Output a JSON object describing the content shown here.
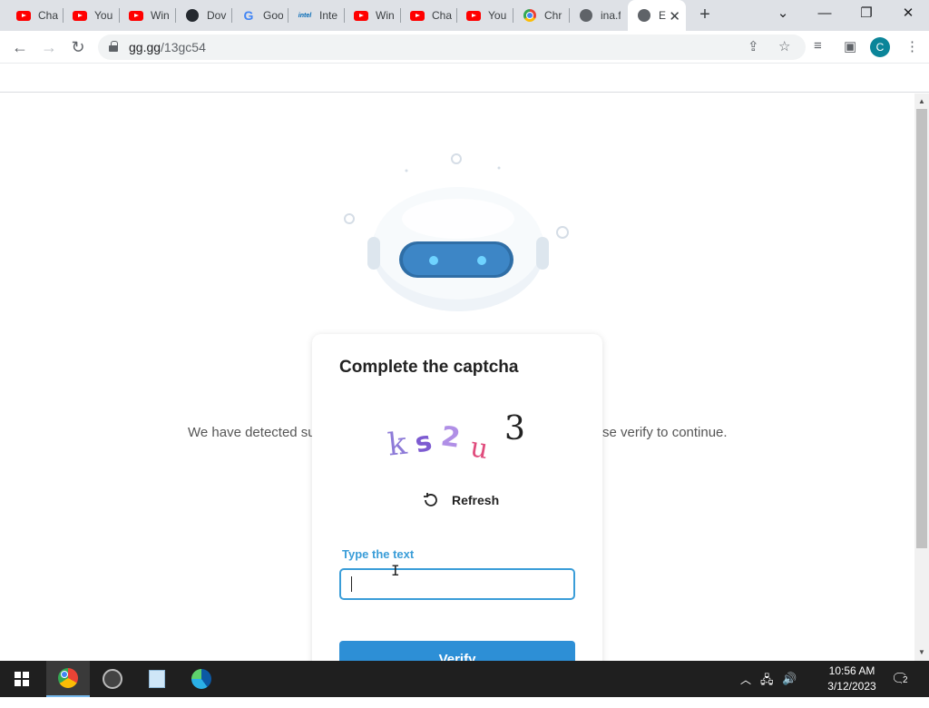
{
  "browser": {
    "tabs": [
      {
        "icon": "youtube-icon",
        "title": "Cha"
      },
      {
        "icon": "youtube-icon",
        "title": "You"
      },
      {
        "icon": "youtube-icon",
        "title": "Win"
      },
      {
        "icon": "github-icon",
        "title": "Dov"
      },
      {
        "icon": "google-icon",
        "title": "Goo"
      },
      {
        "icon": "intel-icon",
        "title": "Inte"
      },
      {
        "icon": "youtube-icon",
        "title": "Win"
      },
      {
        "icon": "youtube-icon",
        "title": "Cha"
      },
      {
        "icon": "youtube-icon",
        "title": "You"
      },
      {
        "icon": "chrome-icon",
        "title": "Chr"
      },
      {
        "icon": "globe-icon",
        "title": "ina.f"
      },
      {
        "icon": "globe-icon",
        "title": "E",
        "active": true
      }
    ],
    "new_tab_label": "+",
    "url_host": "gg.gg",
    "url_path": "/13gc54",
    "profile_initial": "C",
    "intel_text": "intel",
    "google_letter": "G"
  },
  "page": {
    "background_text_left": "We have detected su",
    "background_text_right": "se verify to continue.",
    "captcha_card": {
      "title": "Complete the captcha",
      "captcha_text": "ks2u3",
      "refresh_label": "Refresh",
      "input_label": "Type the text",
      "input_value": "",
      "verify_label": "Verify"
    }
  },
  "taskbar": {
    "time": "10:56 AM",
    "date": "3/12/2023",
    "notification_count": "2"
  },
  "colors": {
    "accent": "#3a9dd8",
    "verify_button": "#2d8fd6",
    "profile": "#0b8599"
  }
}
